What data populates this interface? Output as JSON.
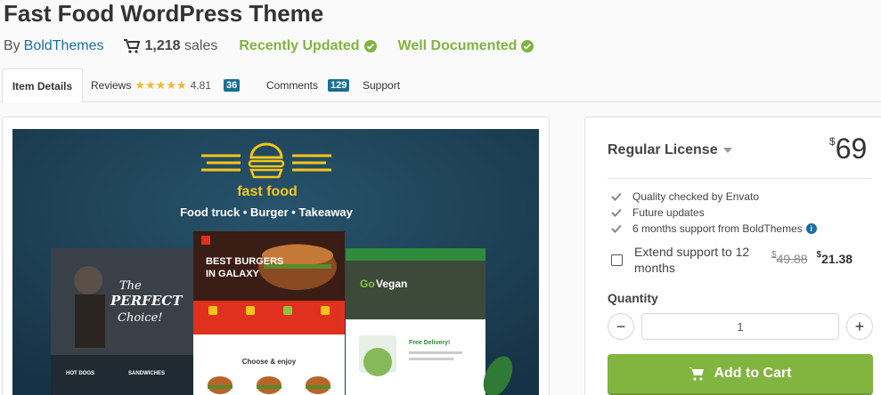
{
  "product": {
    "title": "Fast Food WordPress Theme",
    "by_label": "By",
    "author": "BoldThemes",
    "sales_count": "1,218",
    "sales_label": "sales",
    "badges": [
      "Recently Updated",
      "Well Documented"
    ]
  },
  "tabs": {
    "item_details": "Item Details",
    "reviews": "Reviews",
    "rating": "4.81",
    "stars": "★★★★★",
    "reviews_count": "36",
    "comments": "Comments",
    "comments_count": "129",
    "support": "Support"
  },
  "preview": {
    "brand": "fast food",
    "tagline": "Food truck • Burger • Takeaway",
    "hero_line1": "BEST BURGERS",
    "hero_line2": "IN GALAXY",
    "left_script1": "The",
    "left_script2": "PERFECT",
    "left_script3": "Choice!",
    "left_cat1": "HOT DOGS",
    "left_cat2": "SANDWICHES",
    "vegan_go": "Go",
    "vegan_word": "Vegan",
    "delivery": "Free Delivery!",
    "choose": "Choose & enjoy"
  },
  "license": {
    "name": "Regular License",
    "currency": "$",
    "price": "69",
    "features": [
      "Quality checked by Envato",
      "Future updates",
      "6 months support from BoldThemes"
    ],
    "extend_label": "Extend support to 12 months",
    "extend_old_price": "49.88",
    "extend_new_price": "21.38",
    "quantity_label": "Quantity",
    "quantity_value": "1",
    "minus": "−",
    "plus": "+",
    "add_to_cart": "Add to Cart"
  },
  "colors": {
    "accent_green": "#82b440",
    "link_blue": "#1a6ea3",
    "count_badge": "#1b6e92",
    "star": "#f5b82e",
    "preview_bg": "#1d4157",
    "burger_yellow": "#f5c518",
    "burger_red": "#e0301e"
  }
}
